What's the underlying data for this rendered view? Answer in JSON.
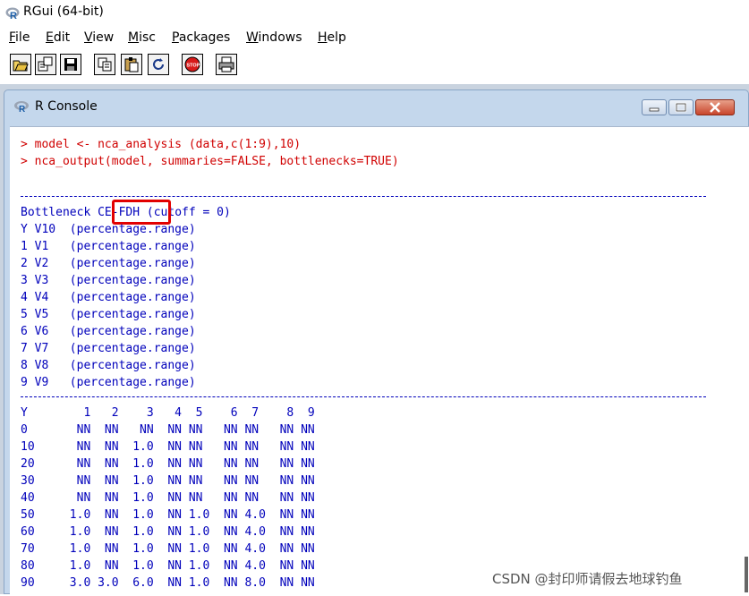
{
  "window": {
    "title": "RGui (64-bit)"
  },
  "menu": [
    {
      "label": "File",
      "accel": "F",
      "rest": "ile"
    },
    {
      "label": "Edit",
      "accel": "E",
      "rest": "dit"
    },
    {
      "label": "View",
      "accel": "V",
      "rest": "iew"
    },
    {
      "label": "Misc",
      "accel": "M",
      "rest": "isc"
    },
    {
      "label": "Packages",
      "accel": "P",
      "rest": "ackages"
    },
    {
      "label": "Windows",
      "accel": "W",
      "rest": "indows"
    },
    {
      "label": "Help",
      "accel": "H",
      "rest": "elp"
    }
  ],
  "toolbar": {
    "icons": [
      "open-script-icon",
      "load-workspace-icon",
      "save-icon",
      "copy-icon",
      "paste-icon",
      "refresh-icon",
      "stop-icon",
      "print-icon"
    ],
    "stop_label": "STOP"
  },
  "console": {
    "title": "R Console",
    "commands": [
      "> model <- nca_analysis (data,c(1:9),10)",
      "> nca_output(model, summaries=FALSE, bottlenecks=TRUE)"
    ],
    "bottleneck_header": {
      "prefix": "Bottleneck ",
      "method": "CE-FDH",
      "suffix": " (cutoff = 0)"
    },
    "variables": [
      "Y V10  (percentage.range)",
      "1 V1   (percentage.range)",
      "2 V2   (percentage.range)",
      "3 V3   (percentage.range)",
      "4 V4   (percentage.range)",
      "5 V5   (percentage.range)",
      "6 V6   (percentage.range)",
      "7 V7   (percentage.range)",
      "8 V8   (percentage.range)",
      "9 V9   (percentage.range)"
    ],
    "table_header": "Y        1   2    3   4  5    6  7    8  9",
    "table_rows": [
      "0       NN  NN   NN  NN NN   NN NN   NN NN",
      "10      NN  NN  1.0  NN NN   NN NN   NN NN",
      "20      NN  NN  1.0  NN NN   NN NN   NN NN",
      "30      NN  NN  1.0  NN NN   NN NN   NN NN",
      "40      NN  NN  1.0  NN NN   NN NN   NN NN",
      "50     1.0  NN  1.0  NN 1.0  NN 4.0  NN NN",
      "60     1.0  NN  1.0  NN 1.0  NN 4.0  NN NN",
      "70     1.0  NN  1.0  NN 1.0  NN 4.0  NN NN",
      "80     1.0  NN  1.0  NN 1.0  NN 4.0  NN NN",
      "90     3.0 3.0  6.0  NN 1.0  NN 8.0  NN NN"
    ]
  },
  "watermark": "CSDN @封印师请假去地球钓鱼",
  "colors": {
    "command": "#d00000",
    "output": "#0000bb",
    "highlight": "#e20000"
  }
}
